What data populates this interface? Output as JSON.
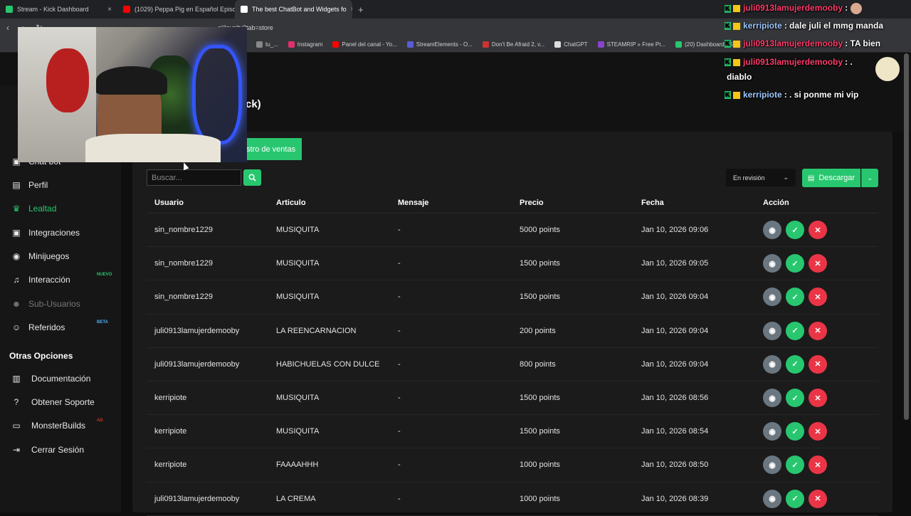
{
  "browser": {
    "tabs": [
      {
        "label": "Stream - Kick Dashboard",
        "icon": "kick-icon",
        "color": "#28c76f",
        "active": false
      },
      {
        "label": "(1029) Peppa Pig en Español Episodio",
        "icon": "youtube-icon",
        "color": "#ff0000",
        "active": false
      },
      {
        "label": "The best ChatBot and Widgets fo",
        "icon": "botrix-icon",
        "color": "#ffffff",
        "active": true
      }
    ],
    "url": "el/loyalty?tab=store",
    "bookmarks": [
      {
        "label": "tu_...",
        "color": "#888888"
      },
      {
        "label": "Instagram",
        "color": "#e1306c"
      },
      {
        "label": "Panel del canal - Yo...",
        "color": "#ff0000"
      },
      {
        "label": "StreamElements - O...",
        "color": "#5b5bd6"
      },
      {
        "label": "Don't Be Afraid 2, v...",
        "color": "#cc3333"
      },
      {
        "label": "ChatGPT",
        "color": "#dddddd"
      },
      {
        "label": "STEAMRIP » Free Pr...",
        "color": "#8844cc"
      },
      {
        "label": "(20) Dashboard / Str...",
        "color": "#28c76f"
      }
    ]
  },
  "page": {
    "title": "ck)",
    "sales_tab": "stro de ventas"
  },
  "sidebar": {
    "items": [
      {
        "label": "Perfil",
        "icon": "id-card-icon",
        "state": "normal"
      },
      {
        "label": "Lealtad",
        "icon": "trophy-icon",
        "state": "active"
      },
      {
        "label": "Integraciones",
        "icon": "puzzle-icon",
        "state": "normal"
      },
      {
        "label": "Minijuegos",
        "icon": "gamepad-icon",
        "state": "normal"
      },
      {
        "label": "Interacción",
        "icon": "music-icon",
        "state": "normal",
        "badge": "NUEVO"
      },
      {
        "label": "Sub-Usuarios",
        "icon": "users-icon",
        "state": "disabled"
      },
      {
        "label": "Referidos",
        "icon": "referral-icon",
        "state": "normal",
        "badge": "BETA"
      }
    ],
    "other_title": "Otras Opciones",
    "other_items": [
      {
        "label": "Documentación",
        "icon": "book-icon"
      },
      {
        "label": "Obtener Soporte",
        "icon": "help-icon"
      },
      {
        "label": "MonsterBuilds",
        "icon": "laptop-icon",
        "badge": "AD"
      },
      {
        "label": "Cerrar Sesión",
        "icon": "logout-icon"
      }
    ],
    "partial_item": "Chat bot"
  },
  "toolbar": {
    "search_placeholder": "Buscar...",
    "status_value": "En revisión",
    "download_label": "Descargar"
  },
  "table": {
    "headers": [
      "Usuario",
      "Articulo",
      "Mensaje",
      "Precio",
      "Fecha",
      "Acción"
    ],
    "rows": [
      [
        "sin_nombre1229",
        "MUSIQUITA",
        "-",
        "5000 points",
        "Jan 10, 2026 09:06"
      ],
      [
        "sin_nombre1229",
        "MUSIQUITA",
        "-",
        "1500 points",
        "Jan 10, 2026 09:05"
      ],
      [
        "sin_nombre1229",
        "MUSIQUITA",
        "-",
        "1500 points",
        "Jan 10, 2026 09:04"
      ],
      [
        "juli0913lamujerdemooby",
        "LA REENCARNACION",
        "-",
        "200 points",
        "Jan 10, 2026 09:04"
      ],
      [
        "juli0913lamujerdemooby",
        "HABICHUELAS CON DULCE",
        "-",
        "800 points",
        "Jan 10, 2026 09:04"
      ],
      [
        "kerripiote",
        "MUSIQUITA",
        "-",
        "1500 points",
        "Jan 10, 2026 08:56"
      ],
      [
        "kerripiote",
        "MUSIQUITA",
        "-",
        "1500 points",
        "Jan 10, 2026 08:54"
      ],
      [
        "kerripiote",
        "FAAAAHHH",
        "-",
        "1000 points",
        "Jan 10, 2026 08:50"
      ],
      [
        "juli0913lamujerdemooby",
        "LA CREMA",
        "-",
        "1000 points",
        "Jan 10, 2026 08:39"
      ]
    ]
  },
  "chat": {
    "messages": [
      {
        "user": "juli0913lamujerdemooby",
        "text": ":",
        "color": "#ff3b6b"
      },
      {
        "user": "kerripiote",
        "text": ": dale juli el mmg manda",
        "color": "#9ec9ff"
      },
      {
        "user": "juli0913lamujerdemooby",
        "text": ": TA bien",
        "color": "#ff3b6b"
      },
      {
        "user": "juli0913lamujerdemooby",
        "text": ": .",
        "color": "#ff3b6b"
      },
      {
        "user": "",
        "text": "diablo",
        "color": "#ffffff"
      },
      {
        "user": "kerripiote",
        "text": ": . si ponme mi vip",
        "color": "#9ec9ff"
      }
    ]
  },
  "colors": {
    "accent": "#28c76f",
    "danger": "#ea3546",
    "view": "#6b7780"
  }
}
